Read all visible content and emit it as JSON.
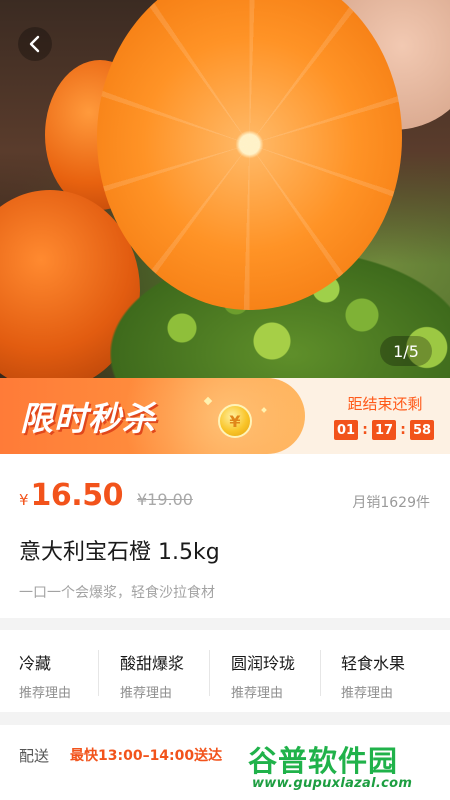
{
  "hero": {
    "image_counter": "1/5",
    "back_icon": "chevron-left-icon"
  },
  "flash_sale": {
    "title": "限时秒杀",
    "coin_symbol": "¥",
    "countdown_label": "距结束还剩",
    "hours": "01",
    "minutes": "17",
    "seconds": "58",
    "separator": ":"
  },
  "product": {
    "currency": "¥",
    "price": "16.50",
    "original_price": "¥19.00",
    "sales": "月销1629件",
    "title": "意大利宝石橙 1.5kg",
    "subtitle": "一口一个会爆浆，轻食沙拉食材"
  },
  "features": [
    {
      "title": "冷藏",
      "sub": "推荐理由"
    },
    {
      "title": "酸甜爆浆",
      "sub": "推荐理由"
    },
    {
      "title": "圆润玲珑",
      "sub": "推荐理由"
    },
    {
      "title": "轻食水果",
      "sub": "推荐理由"
    }
  ],
  "delivery": {
    "label": "配送",
    "value": "最快13:00–14:00送达"
  },
  "watermark": {
    "brand_a": "谷普",
    "brand_b": "软件园",
    "url": "www.gupuxlazal.com"
  },
  "colors": {
    "accent": "#f2531b",
    "flash_gradient_start": "#ff7b38",
    "watermark_green": "#20b24a"
  }
}
